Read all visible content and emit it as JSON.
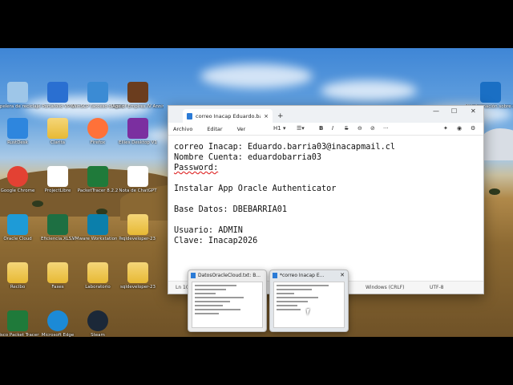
{
  "desktop_icons": [
    {
      "label": "Papelera de reciclaje",
      "icon": "recycle-bin-icon"
    },
    {
      "label": "Portafolio VPN",
      "icon": "vpn-icon"
    },
    {
      "label": "WinSCP (acceso directo)",
      "icon": "winscp-icon"
    },
    {
      "label": "Age of Empires IV Anniversary Edition",
      "icon": "game-icon"
    },
    {
      "label": "RustDesk",
      "icon": "rustdesk-icon"
    },
    {
      "label": "Clarita",
      "icon": "folder-icon"
    },
    {
      "label": "Firefox",
      "icon": "firefox-icon"
    },
    {
      "label": "Ellies Desktop V1",
      "icon": "el-icon"
    },
    {
      "label": "Google Chrome",
      "icon": "chrome-icon"
    },
    {
      "label": "ProjectLibre",
      "icon": "projectlibre-icon"
    },
    {
      "label": "PacketTracer 8.2.2",
      "icon": "packettracer-icon"
    },
    {
      "label": "Nota de ChatGPT",
      "icon": "document-icon"
    },
    {
      "label": "Oracle Cloud",
      "icon": "cloud-app-icon"
    },
    {
      "label": "Eficiencia.XLSX",
      "icon": "excel-icon"
    },
    {
      "label": "VMware Workstation Pro",
      "icon": "vmware-icon"
    },
    {
      "label": "sqldeveloper-23",
      "icon": "folder-icon"
    },
    {
      "label": "Recibo",
      "icon": "folder-icon"
    },
    {
      "label": "Faxes",
      "icon": "folder-icon"
    },
    {
      "label": "Laboratorio",
      "icon": "folder-icon"
    },
    {
      "label": "sqldeveloper-23",
      "icon": "folder-icon"
    },
    {
      "label": "Cisco Packet Tracer",
      "icon": "packettracer-icon"
    },
    {
      "label": "Microsoft Edge",
      "icon": "edge-icon"
    },
    {
      "label": "Steam",
      "icon": "steam-icon"
    },
    {
      "label": "Mi información sobre esta imagen",
      "icon": "info-icon"
    }
  ],
  "notepad": {
    "tab_title": "correo Inacap Eduardo.barria03@i",
    "menu": [
      "Archivo",
      "Editar",
      "Ver"
    ],
    "heading_level": "H1",
    "lines": [
      "correo Inacap: Eduardo.barria03@inacapmail.cl",
      "Nombre Cuenta: eduardobarria03",
      "Password:",
      "",
      "Instalar App Oracle Authenticator",
      "",
      "Base Datos: DBEBARRIA01",
      "",
      "Usuario: ADMIN",
      "Clave: Inacap2026"
    ],
    "status": {
      "position": "Ln 10",
      "line_ending": "Windows (CRLF)",
      "encoding": "UTF-8"
    }
  },
  "taskbar_previews": [
    {
      "title": "DatosOracleCloud.txt: B..."
    },
    {
      "title": "*correo Inacap E..."
    }
  ]
}
